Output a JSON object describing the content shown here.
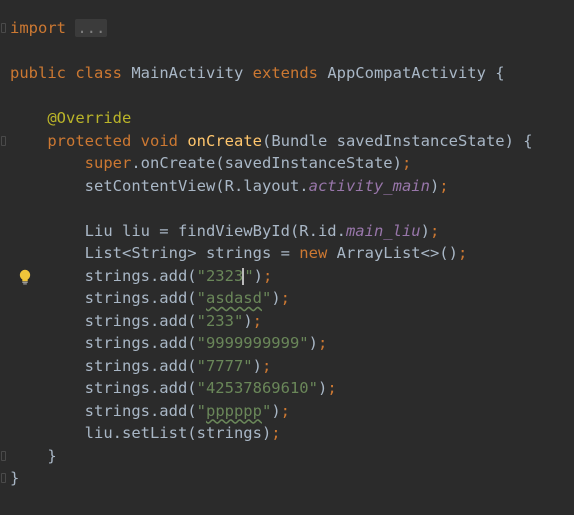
{
  "editor": {
    "language": "java",
    "caret_line": 12,
    "lines": [
      {
        "tokens": [
          {
            "t": "import ",
            "c": "kw"
          },
          {
            "t": "...",
            "c": "fold"
          }
        ]
      },
      {
        "tokens": []
      },
      {
        "tokens": [
          {
            "t": "public ",
            "c": "kw"
          },
          {
            "t": "class ",
            "c": "kw"
          },
          {
            "t": "MainActivity ",
            "c": "plain"
          },
          {
            "t": "extends ",
            "c": "kw"
          },
          {
            "t": "AppCompatActivity {",
            "c": "plain"
          }
        ]
      },
      {
        "tokens": []
      },
      {
        "tokens": [
          {
            "t": "    "
          },
          {
            "t": "@Override",
            "c": "ann"
          }
        ]
      },
      {
        "tokens": [
          {
            "t": "    "
          },
          {
            "t": "protected ",
            "c": "kw"
          },
          {
            "t": "void ",
            "c": "kw"
          },
          {
            "t": "onCreate",
            "c": "fn"
          },
          {
            "t": "(Bundle savedInstanceState) {",
            "c": "plain"
          }
        ]
      },
      {
        "tokens": [
          {
            "t": "        "
          },
          {
            "t": "super",
            "c": "kw"
          },
          {
            "t": ".onCreate(savedInstanceState)",
            "c": "plain"
          },
          {
            "t": ";",
            "c": "kw"
          }
        ]
      },
      {
        "tokens": [
          {
            "t": "        "
          },
          {
            "t": "setContentView(R.layout.",
            "c": "plain"
          },
          {
            "t": "activity_main",
            "c": "fld"
          },
          {
            "t": ")",
            "c": "plain"
          },
          {
            "t": ";",
            "c": "kw"
          }
        ]
      },
      {
        "tokens": []
      },
      {
        "tokens": [
          {
            "t": "        "
          },
          {
            "t": "Liu liu = findViewById(R.id.",
            "c": "plain"
          },
          {
            "t": "main_liu",
            "c": "fld"
          },
          {
            "t": ")",
            "c": "plain"
          },
          {
            "t": ";",
            "c": "kw"
          }
        ]
      },
      {
        "tokens": [
          {
            "t": "        "
          },
          {
            "t": "List<String> strings = ",
            "c": "plain"
          },
          {
            "t": "new ",
            "c": "kw"
          },
          {
            "t": "ArrayList<>()",
            "c": "plain"
          },
          {
            "t": ";",
            "c": "kw"
          }
        ]
      },
      {
        "tokens": [
          {
            "t": "        "
          },
          {
            "t": "strings.add(",
            "c": "plain"
          },
          {
            "t": "\"2323",
            "c": "str"
          },
          {
            "t": "",
            "c": "caret"
          },
          {
            "t": "\"",
            "c": "str"
          },
          {
            "t": ")",
            "c": "plain"
          },
          {
            "t": ";",
            "c": "kw"
          }
        ],
        "bulb": true
      },
      {
        "tokens": [
          {
            "t": "        "
          },
          {
            "t": "strings.add(",
            "c": "plain"
          },
          {
            "t": "\"",
            "c": "str"
          },
          {
            "t": "asdasd",
            "c": "str-squiggle"
          },
          {
            "t": "\"",
            "c": "str"
          },
          {
            "t": ")",
            "c": "plain"
          },
          {
            "t": ";",
            "c": "kw"
          }
        ]
      },
      {
        "tokens": [
          {
            "t": "        "
          },
          {
            "t": "strings.add(",
            "c": "plain"
          },
          {
            "t": "\"233\"",
            "c": "str"
          },
          {
            "t": ")",
            "c": "plain"
          },
          {
            "t": ";",
            "c": "kw"
          }
        ]
      },
      {
        "tokens": [
          {
            "t": "        "
          },
          {
            "t": "strings.add(",
            "c": "plain"
          },
          {
            "t": "\"9999999999\"",
            "c": "str"
          },
          {
            "t": ")",
            "c": "plain"
          },
          {
            "t": ";",
            "c": "kw"
          }
        ]
      },
      {
        "tokens": [
          {
            "t": "        "
          },
          {
            "t": "strings.add(",
            "c": "plain"
          },
          {
            "t": "\"7777\"",
            "c": "str"
          },
          {
            "t": ")",
            "c": "plain"
          },
          {
            "t": ";",
            "c": "kw"
          }
        ]
      },
      {
        "tokens": [
          {
            "t": "        "
          },
          {
            "t": "strings.add(",
            "c": "plain"
          },
          {
            "t": "\"42537869610\"",
            "c": "str"
          },
          {
            "t": ")",
            "c": "plain"
          },
          {
            "t": ";",
            "c": "kw"
          }
        ]
      },
      {
        "tokens": [
          {
            "t": "        "
          },
          {
            "t": "strings.add(",
            "c": "plain"
          },
          {
            "t": "\"",
            "c": "str"
          },
          {
            "t": "pppppp",
            "c": "str-squiggle"
          },
          {
            "t": "\"",
            "c": "str"
          },
          {
            "t": ")",
            "c": "plain"
          },
          {
            "t": ";",
            "c": "kw"
          }
        ]
      },
      {
        "tokens": [
          {
            "t": "        "
          },
          {
            "t": "liu.setList(strings)",
            "c": "plain"
          },
          {
            "t": ";",
            "c": "kw"
          }
        ]
      },
      {
        "tokens": [
          {
            "t": "    "
          },
          {
            "t": "}",
            "c": "plain"
          }
        ]
      },
      {
        "tokens": [
          {
            "t": "}",
            "c": "plain"
          }
        ]
      }
    ]
  },
  "icons": {
    "intention_bulb": "lightbulb-icon",
    "fold_marker": "fold-marker-icon"
  },
  "colors": {
    "background": "#2b2b2b",
    "default_text": "#a9b7c6",
    "keyword": "#cc7832",
    "annotation": "#bbb529",
    "string": "#6a8759",
    "method_declaration": "#ffc66d",
    "field": "#9876aa"
  }
}
